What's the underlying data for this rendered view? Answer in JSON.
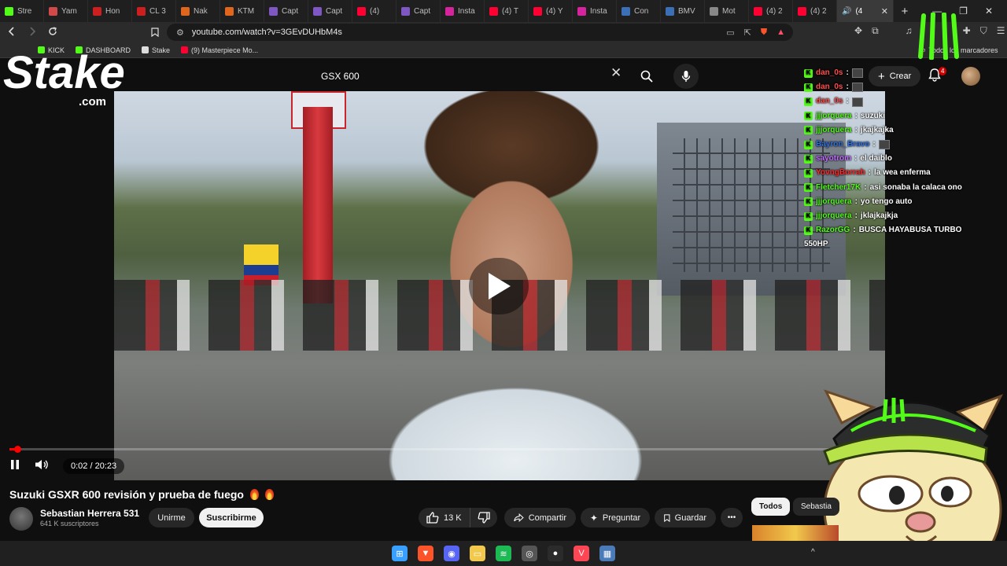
{
  "browser": {
    "tabs": [
      {
        "label": "Stre",
        "color": "#53fc18"
      },
      {
        "label": "Yam",
        "color": "#d04a4a"
      },
      {
        "label": "Hon",
        "color": "#cc1f1f"
      },
      {
        "label": "CL 3",
        "color": "#cc1f1f"
      },
      {
        "label": "Nak",
        "color": "#e0661e"
      },
      {
        "label": "KTM",
        "color": "#e0661e"
      },
      {
        "label": "Capt",
        "color": "#7e57c2"
      },
      {
        "label": "Capt",
        "color": "#7e57c2"
      },
      {
        "label": "(4)",
        "color": "#ff0033"
      },
      {
        "label": "Capt",
        "color": "#7e57c2"
      },
      {
        "label": "Insta",
        "color": "#d6249f"
      },
      {
        "label": "(4) T",
        "color": "#ff0033"
      },
      {
        "label": "(4) Y",
        "color": "#ff0033"
      },
      {
        "label": "Insta",
        "color": "#d6249f"
      },
      {
        "label": "Con",
        "color": "#3b6fb6"
      },
      {
        "label": "BMV",
        "color": "#3b6fb6"
      },
      {
        "label": "Mot",
        "color": "#888888"
      },
      {
        "label": "(4) 2",
        "color": "#ff0033"
      },
      {
        "label": "(4) 2",
        "color": "#ff0033"
      }
    ],
    "active_tab": {
      "label": "(4",
      "close": "✕"
    },
    "new_tab": "+",
    "window_controls": {
      "minimize": "—",
      "maximize": "❐",
      "close": "✕"
    },
    "url": "youtube.com/watch?v=3GEvDUHbM4s",
    "bookmarks": [
      {
        "label": "KICK",
        "color": "#53fc18"
      },
      {
        "label": "DASHBOARD",
        "color": "#53fc18"
      },
      {
        "label": "Stake",
        "color": "#dddddd"
      },
      {
        "label": "(9) Masterpiece Mo...",
        "color": "#ff0033"
      }
    ],
    "bookmarks_all": "Todos los marcadores"
  },
  "youtube": {
    "search_query": "GSX 600",
    "create_label": "Crear",
    "notification_count": "4",
    "player": {
      "current_time": "0:02",
      "duration": "20:23",
      "time_display": "0:02 / 20:23",
      "progress_fraction": 0.0016
    },
    "video": {
      "title": "Suzuki GSXR 600 revisión y prueba de fuego",
      "channel_name": "Sebastian Herrera 531",
      "subscribers": "641 K suscriptores",
      "join_label": "Unirme",
      "subscribe_label": "Suscribirme",
      "likes": "13 K",
      "share_label": "Compartir",
      "ask_label": "Preguntar",
      "save_label": "Guardar",
      "more_label": "•••"
    },
    "chips": {
      "all": "Todos",
      "channel": "Sebastia"
    }
  },
  "overlay": {
    "stake_logo": "Stake",
    "stake_sub": ".com",
    "chat": [
      {
        "user": "dan_0s",
        "color": "#ff4d4d",
        "msg": "",
        "emote": true
      },
      {
        "user": "dan_0s",
        "color": "#ff4d4d",
        "msg": "",
        "emote": true
      },
      {
        "user": "dan_0s",
        "color": "#ff4d4d",
        "msg": "",
        "emote": true
      },
      {
        "user": "jjjorquera",
        "color": "#53fc18",
        "msg": "suzuki",
        "emote": false
      },
      {
        "user": "jjjorquera",
        "color": "#53fc18",
        "msg": "jkajkajka",
        "emote": false
      },
      {
        "user": "Bayron_Bravo",
        "color": "#2f6fe0",
        "msg": "",
        "emote": true
      },
      {
        "user": "sayotrom",
        "color": "#c26bff",
        "msg": "el daiblo",
        "emote": false
      },
      {
        "user": "YovngBorrah",
        "color": "#ff2a2a",
        "msg": "la wea enferma",
        "emote": false
      },
      {
        "user": "Fletcher17K",
        "color": "#53fc18",
        "msg": "asi sonaba la calaca ono",
        "emote": false
      },
      {
        "user": "jjjorquera",
        "color": "#53fc18",
        "msg": "yo tengo auto",
        "emote": false
      },
      {
        "user": "jjjorquera",
        "color": "#53fc18",
        "msg": "jklajkajkja",
        "emote": false
      },
      {
        "user": "RazorGG",
        "color": "#53fc18",
        "msg": "BUSCA HAYABUSA TURBO",
        "emote": false
      }
    ],
    "chat_wrap": "550HP"
  },
  "taskbar": {
    "icons": [
      {
        "name": "windows-start-icon",
        "color": "#3aa0ff",
        "glyph": "⊞"
      },
      {
        "name": "brave-browser-icon",
        "color": "#fb542b",
        "glyph": "▼"
      },
      {
        "name": "discord-icon",
        "color": "#5865f2",
        "glyph": "◉"
      },
      {
        "name": "file-explorer-icon",
        "color": "#f2c94c",
        "glyph": "▭"
      },
      {
        "name": "spotify-icon",
        "color": "#1db954",
        "glyph": "≋"
      },
      {
        "name": "obs-icon",
        "color": "#555555",
        "glyph": "◎"
      },
      {
        "name": "app-dark-icon",
        "color": "#2b2b2b",
        "glyph": "●"
      },
      {
        "name": "valorant-icon",
        "color": "#ff4655",
        "glyph": "V"
      },
      {
        "name": "calculator-icon",
        "color": "#4a7ab8",
        "glyph": "▦"
      }
    ],
    "tray": "^"
  }
}
